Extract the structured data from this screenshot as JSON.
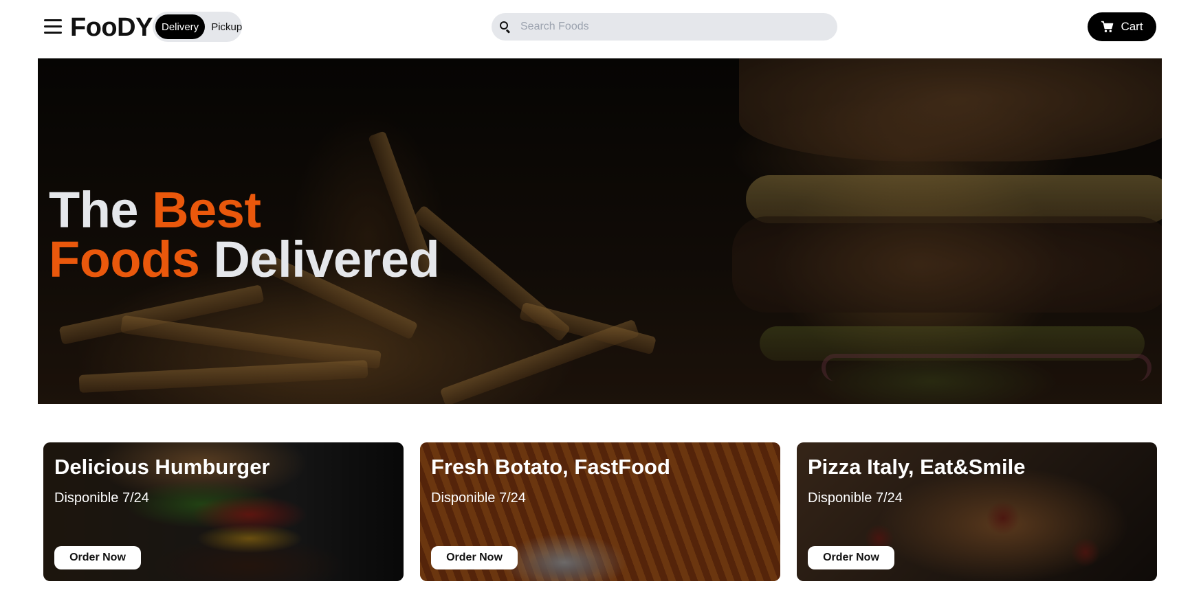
{
  "header": {
    "logo": "FooDY",
    "modes": [
      {
        "label": "Delivery",
        "active": true
      },
      {
        "label": "Pickup",
        "active": false
      }
    ],
    "search": {
      "placeholder": "Search Foods",
      "value": ""
    },
    "cart_label": "Cart"
  },
  "hero": {
    "line1_plain": "The",
    "line1_accent": "Best",
    "line2_accent": "Foods",
    "line2_plain": "Delivered",
    "accent_color": "#ea580c"
  },
  "cards": [
    {
      "title": "Delicious Humburger",
      "subtitle": "Disponible 7/24",
      "button": "Order Now"
    },
    {
      "title": "Fresh Botato, FastFood",
      "subtitle": "Disponible 7/24",
      "button": "Order Now"
    },
    {
      "title": "Pizza Italy, Eat&Smile",
      "subtitle": "Disponible 7/24",
      "button": "Order Now"
    }
  ],
  "icons": {
    "menu": "hamburger-menu-icon",
    "search": "search-icon",
    "cart": "shopping-cart-icon"
  }
}
